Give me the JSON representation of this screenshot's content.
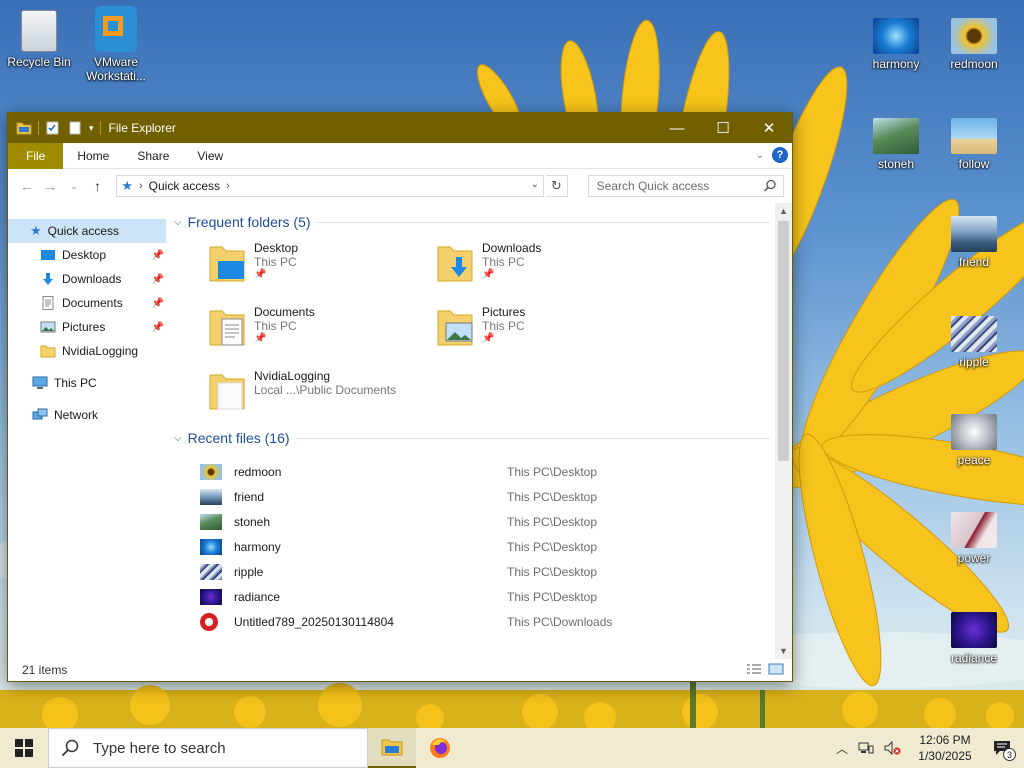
{
  "desktop": {
    "icons": [
      {
        "label": "Recycle Bin"
      },
      {
        "label": "VMware Workstati..."
      },
      {
        "label": "harmony"
      },
      {
        "label": "redmoon"
      },
      {
        "label": "stoneh"
      },
      {
        "label": "follow"
      },
      {
        "label": "friend"
      },
      {
        "label": "ripple"
      },
      {
        "label": "peace"
      },
      {
        "label": "power"
      },
      {
        "label": "radiance"
      }
    ]
  },
  "window": {
    "title": "File Explorer",
    "controls": {
      "minimize": "—",
      "maximize": "☐",
      "close": "✕"
    },
    "ribbon": {
      "tabs": [
        "File",
        "Home",
        "Share",
        "View"
      ],
      "help": "?"
    },
    "address": {
      "crumb": "Quick access"
    },
    "search": {
      "placeholder": "Search Quick access"
    },
    "sidebar": {
      "quick_access": "Quick access",
      "pinned": [
        "Desktop",
        "Downloads",
        "Documents",
        "Pictures"
      ],
      "nvidia": "NvidiaLogging",
      "this_pc": "This PC",
      "network": "Network"
    },
    "frequent": {
      "header": "Frequent folders (5)",
      "items": [
        {
          "name": "Desktop",
          "sub": "This PC"
        },
        {
          "name": "Downloads",
          "sub": "This PC"
        },
        {
          "name": "Documents",
          "sub": "This PC"
        },
        {
          "name": "Pictures",
          "sub": "This PC"
        },
        {
          "name": "NvidiaLogging",
          "sub": "Local ...\\Public Documents"
        }
      ]
    },
    "recent": {
      "header": "Recent files (16)",
      "items": [
        {
          "name": "redmoon",
          "path": "This PC\\Desktop"
        },
        {
          "name": "friend",
          "path": "This PC\\Desktop"
        },
        {
          "name": "stoneh",
          "path": "This PC\\Desktop"
        },
        {
          "name": "harmony",
          "path": "This PC\\Desktop"
        },
        {
          "name": "ripple",
          "path": "This PC\\Desktop"
        },
        {
          "name": "radiance",
          "path": "This PC\\Desktop"
        },
        {
          "name": "Untitled789_20250130114804",
          "path": "This PC\\Downloads"
        }
      ]
    },
    "status": "21 items"
  },
  "taskbar": {
    "search_placeholder": "Type here to search",
    "time": "12:06 PM",
    "date": "1/30/2025",
    "notifications": "3"
  }
}
